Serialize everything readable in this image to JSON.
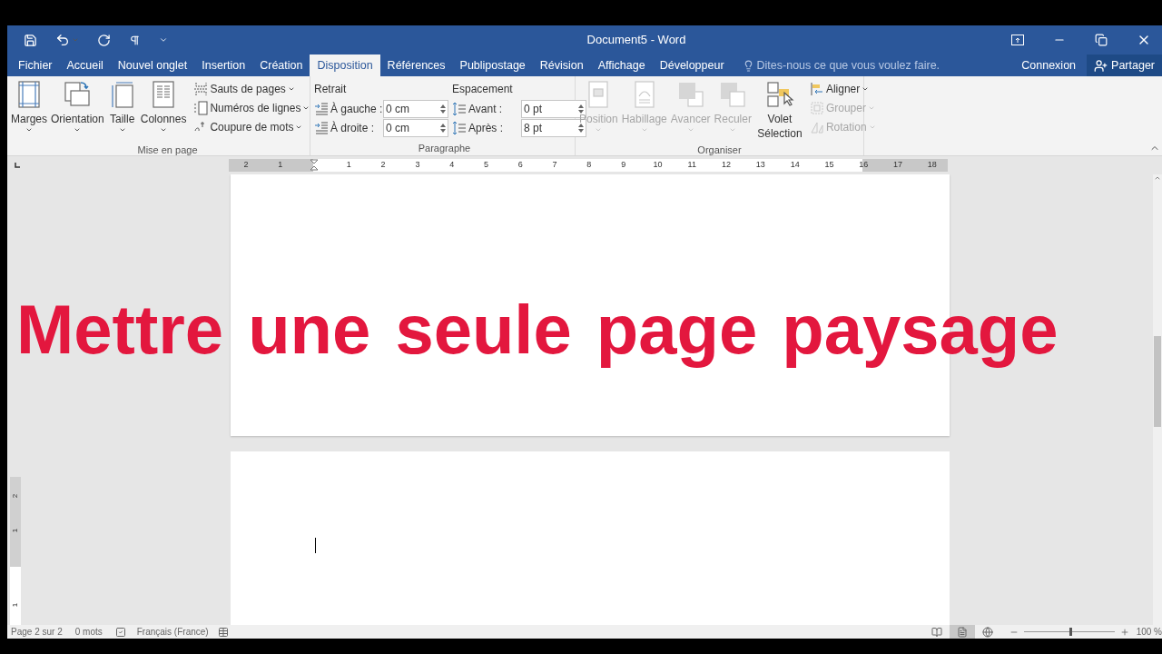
{
  "window": {
    "title": "Document5 - Word"
  },
  "tabs": [
    {
      "label": "Fichier",
      "selected": false
    },
    {
      "label": "Accueil",
      "selected": false
    },
    {
      "label": "Nouvel onglet",
      "selected": false
    },
    {
      "label": "Insertion",
      "selected": false
    },
    {
      "label": "Création",
      "selected": false
    },
    {
      "label": "Disposition",
      "selected": true
    },
    {
      "label": "Références",
      "selected": false
    },
    {
      "label": "Publipostage",
      "selected": false
    },
    {
      "label": "Révision",
      "selected": false
    },
    {
      "label": "Affichage",
      "selected": false
    },
    {
      "label": "Développeur",
      "selected": false
    }
  ],
  "tell_me": {
    "placeholder": "Dites-nous ce que vous voulez faire."
  },
  "account": {
    "sign_in": "Connexion",
    "share": "Partager"
  },
  "ribbon": {
    "page_setup": {
      "title": "Mise en page",
      "large_buttons": [
        {
          "kind": "margins",
          "label": "Marges"
        },
        {
          "kind": "orientation",
          "label": "Orientation"
        },
        {
          "kind": "size",
          "label": "Taille"
        },
        {
          "kind": "columns",
          "label": "Colonnes"
        }
      ],
      "small_buttons": [
        {
          "kind": "breaks",
          "label": "Sauts de pages"
        },
        {
          "kind": "line_numbers",
          "label": "Numéros de lignes"
        },
        {
          "kind": "hyphenation",
          "label": "Coupure de mots"
        }
      ]
    },
    "paragraph": {
      "title": "Paragraphe",
      "indent_title": "Retrait",
      "spacing_title": "Espacement",
      "indent_fields": [
        {
          "label": "À gauche :",
          "value": "0 cm"
        },
        {
          "label": "À droite :",
          "value": "0 cm"
        }
      ],
      "spacing_fields": [
        {
          "label": "Avant :",
          "value": "0 pt"
        },
        {
          "label": "Après :",
          "value": "8 pt"
        }
      ]
    },
    "arrange": {
      "title": "Organiser",
      "large_buttons": [
        {
          "kind": "position",
          "label": "Position",
          "disabled": true
        },
        {
          "kind": "wrap",
          "label": "Habillage",
          "disabled": true
        },
        {
          "kind": "forward",
          "label": "Avancer",
          "disabled": true
        },
        {
          "kind": "backward",
          "label": "Reculer",
          "disabled": true
        },
        {
          "kind": "pane",
          "label": "Volet Sélection",
          "disabled": false
        }
      ],
      "small_buttons": [
        {
          "kind": "align",
          "label": "Aligner",
          "disabled": false
        },
        {
          "kind": "group",
          "label": "Grouper",
          "disabled": true
        },
        {
          "kind": "rotate",
          "label": "Rotation",
          "disabled": true
        }
      ]
    }
  },
  "ruler": {
    "left_labels": [
      "2",
      "1"
    ],
    "labels": [
      "1",
      "2",
      "3",
      "4",
      "5",
      "6",
      "7",
      "8",
      "9",
      "10",
      "11",
      "12",
      "13",
      "14",
      "15",
      "16",
      "17",
      "18"
    ]
  },
  "vertical_ruler": [
    "2",
    "1",
    "1"
  ],
  "overlay_title": "Mettre une seule page paysage",
  "status_bar": {
    "page": "Page 2 sur 2",
    "words": "0 mots",
    "language": "Français (France)",
    "views": [
      {
        "kind": "read",
        "selected": false
      },
      {
        "kind": "print",
        "selected": true
      },
      {
        "kind": "web",
        "selected": false
      }
    ],
    "zoom": {
      "level": 0.5,
      "reading": "100 %"
    }
  }
}
